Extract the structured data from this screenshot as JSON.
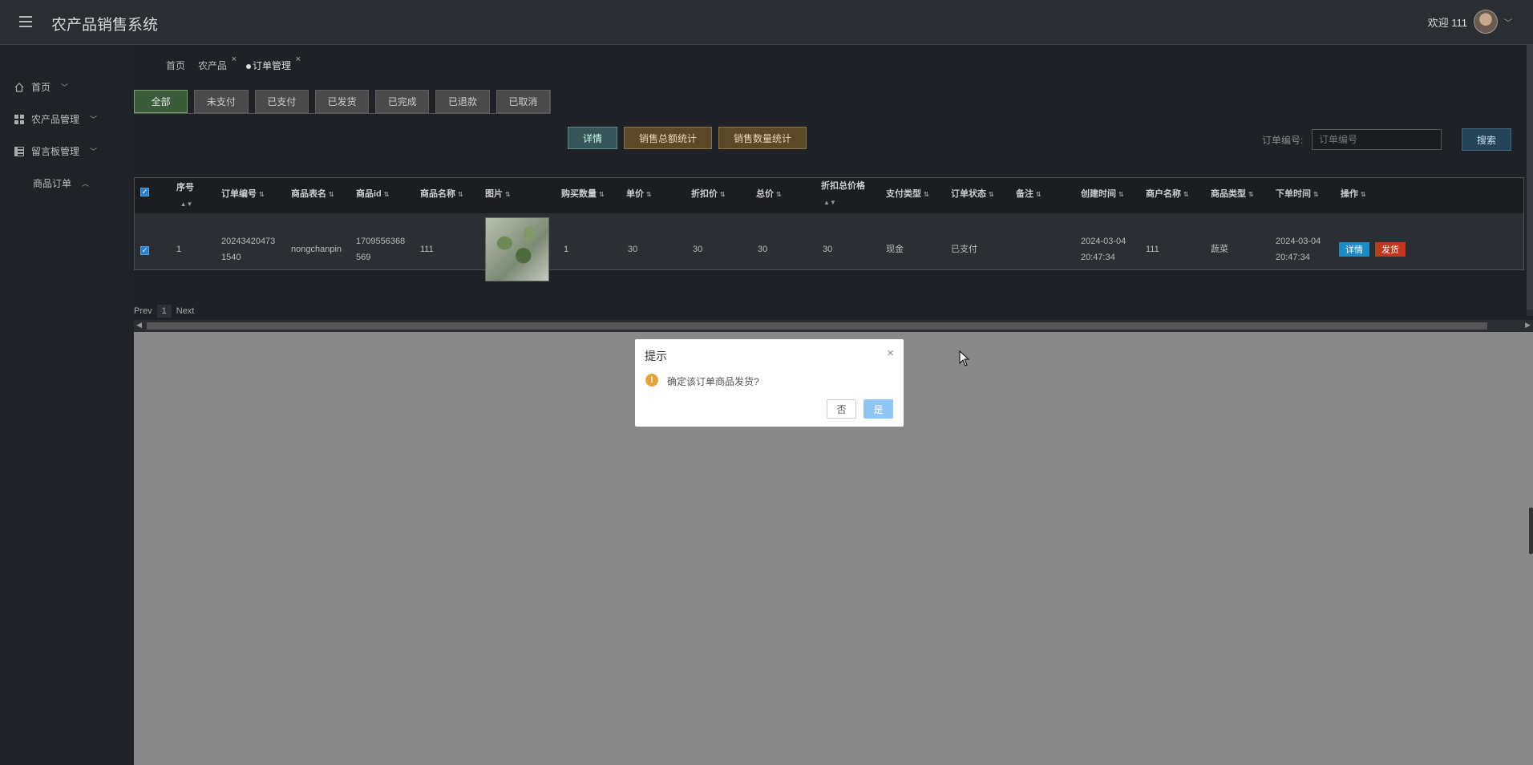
{
  "app": {
    "title": "农产品销售系统",
    "welcome": "欢迎 111"
  },
  "sidebar": {
    "items": [
      {
        "label": "首页",
        "chevron": "﹀"
      },
      {
        "label": "农产品管理",
        "chevron": "﹀"
      },
      {
        "label": "留言板管理",
        "chevron": "﹀"
      },
      {
        "label": "商品订单",
        "chevron": "︿"
      }
    ]
  },
  "breadcrumb": [
    {
      "label": "首页"
    },
    {
      "label": "农产品",
      "close": "×"
    },
    {
      "label": "订单管理",
      "close": "×"
    }
  ],
  "status_tabs": [
    "全部",
    "未支付",
    "已支付",
    "已发货",
    "已完成",
    "已退款",
    "已取消"
  ],
  "actions": {
    "detail": "详情",
    "sales_amount": "销售总额统计",
    "sales_qty": "销售数量统计"
  },
  "search": {
    "label": "订单编号:",
    "placeholder": "订单编号",
    "button": "搜索"
  },
  "table": {
    "headers": [
      "序号",
      "订单编号",
      "商品表名",
      "商品id",
      "商品名称",
      "图片",
      "购买数量",
      "单价",
      "折扣价",
      "总价",
      "折扣总价格",
      "支付类型",
      "订单状态",
      "备注",
      "创建时间",
      "商户名称",
      "商品类型",
      "下单时间",
      "操作"
    ],
    "rows": [
      {
        "index": "1",
        "order_no_1": "20243420473",
        "order_no_2": "1540",
        "table_name": "nongchanpin",
        "goods_id_1": "1709556368",
        "goods_id_2": "569",
        "goods_name": "111",
        "qty": "1",
        "price": "30",
        "discount_price": "30",
        "total": "30",
        "discount_total": "30",
        "pay_type": "现金",
        "status": "已支付",
        "remark": "",
        "created_1": "2024-03-04",
        "created_2": "20:47:34",
        "merchant": "111",
        "goods_type": "蔬菜",
        "order_time_1": "2024-03-04",
        "order_time_2": "20:47:34",
        "op_detail": "详情",
        "op_ship": "发货"
      }
    ]
  },
  "pager": {
    "prev": "Prev",
    "current": "1",
    "next": "Next"
  },
  "modal": {
    "title": "提示",
    "message": "确定该订单商品发货?",
    "no": "否",
    "yes": "是",
    "close": "×",
    "icon_glyph": "!"
  },
  "colors": {
    "accent": "#1c8cc7",
    "danger": "#c3361e",
    "warning": "#e6a23c",
    "confirm": "#8fc6f3"
  }
}
